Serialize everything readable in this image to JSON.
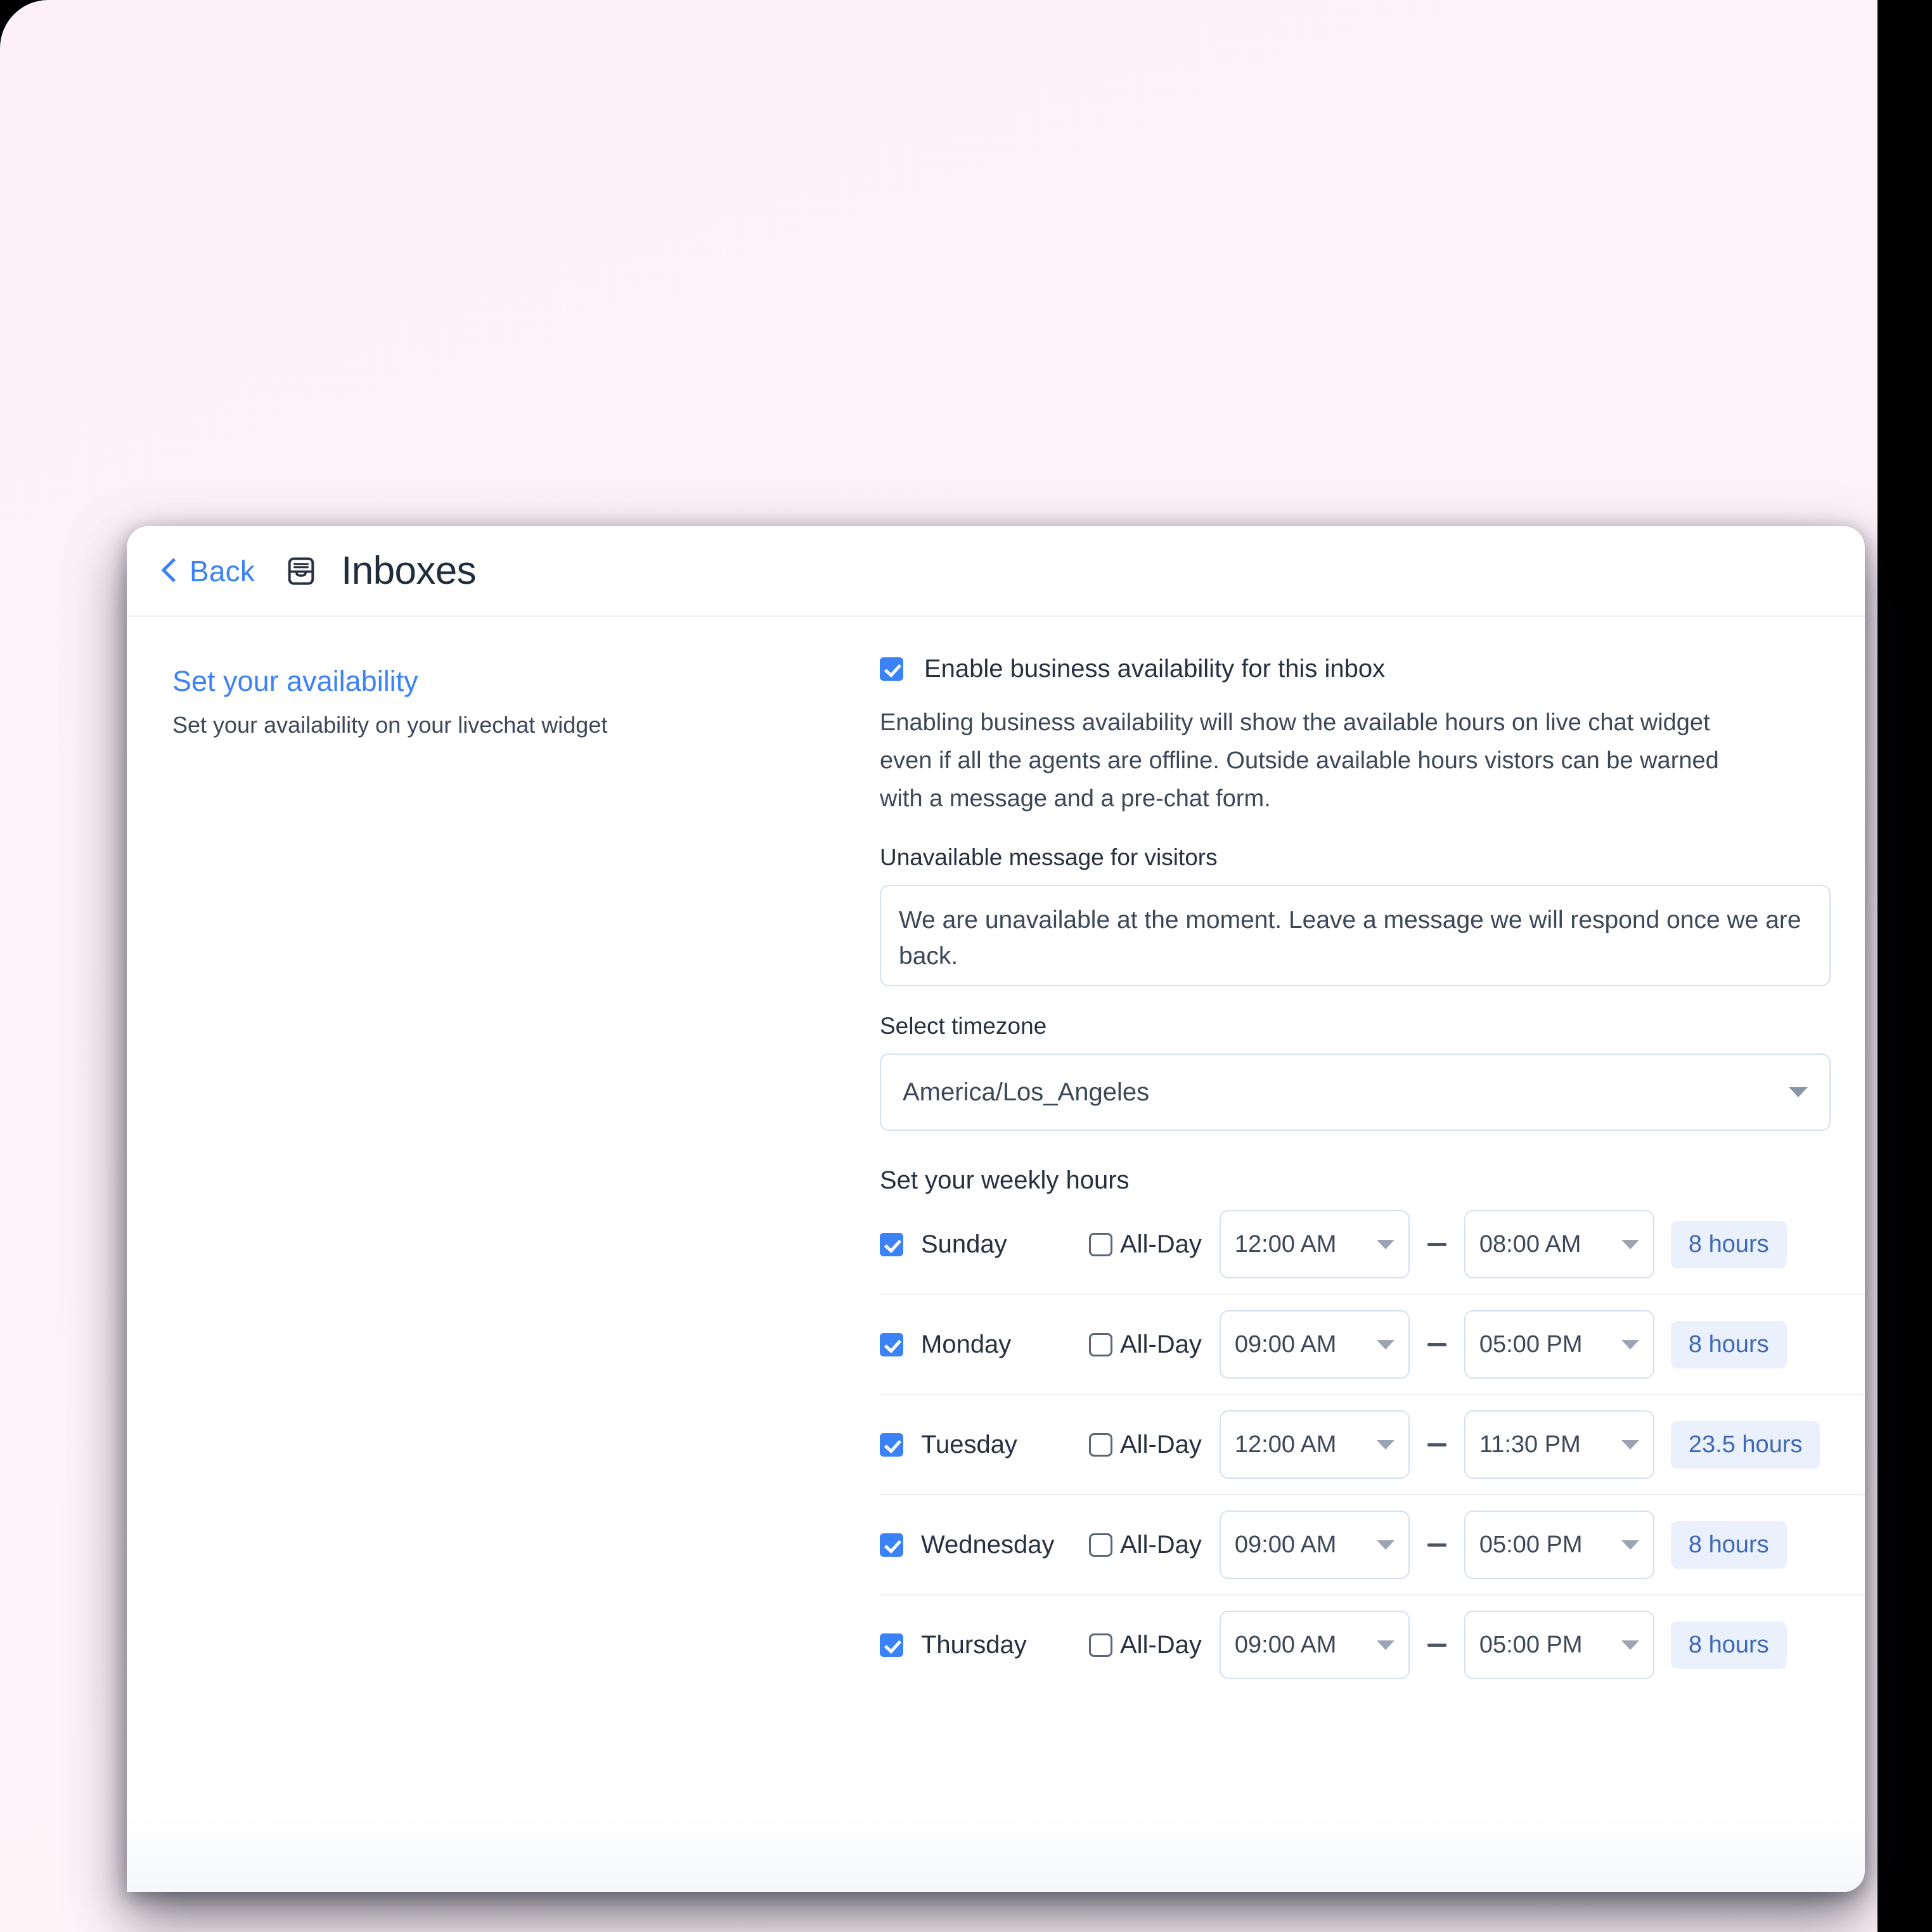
{
  "header": {
    "back_label": "Back",
    "inbox_icon": "inbox-icon",
    "title": "Inboxes"
  },
  "left_panel": {
    "title": "Set your availability",
    "subtitle": "Set your availability on your livechat widget"
  },
  "availability": {
    "enable_label": "Enable business availability for this inbox",
    "enable_checked": true,
    "description": "Enabling business availability will show the available hours on live chat widget even if all the agents are offline. Outside available hours vistors can be warned with a message and a pre-chat form.",
    "unavailable_message_label": "Unavailable message for visitors",
    "unavailable_message_value": "We are unavailable at the moment. Leave a message we will respond once we are back.",
    "timezone_label": "Select timezone",
    "timezone_value": "America/Los_Angeles",
    "weekly_hours_label": "Set your weekly hours",
    "all_day_label": "All-Day"
  },
  "days": [
    {
      "name": "Sunday",
      "enabled": true,
      "all_day": false,
      "start": "12:00 AM",
      "end": "08:00 AM",
      "duration": "8 hours"
    },
    {
      "name": "Monday",
      "enabled": true,
      "all_day": false,
      "start": "09:00 AM",
      "end": "05:00 PM",
      "duration": "8 hours"
    },
    {
      "name": "Tuesday",
      "enabled": true,
      "all_day": false,
      "start": "12:00 AM",
      "end": "11:30 PM",
      "duration": "23.5 hours"
    },
    {
      "name": "Wednesday",
      "enabled": true,
      "all_day": false,
      "start": "09:00 AM",
      "end": "05:00 PM",
      "duration": "8 hours"
    },
    {
      "name": "Thursday",
      "enabled": true,
      "all_day": false,
      "start": "09:00 AM",
      "end": "05:00 PM",
      "duration": "8 hours"
    }
  ],
  "colors": {
    "accent_blue": "#3b82f6",
    "text_dark": "#26303f",
    "text_body": "#3c4858",
    "badge_bg": "#eaf1fd",
    "badge_text": "#3d68b5",
    "border": "#d6e0ee",
    "backdrop_pink": "#fdf2f8"
  }
}
